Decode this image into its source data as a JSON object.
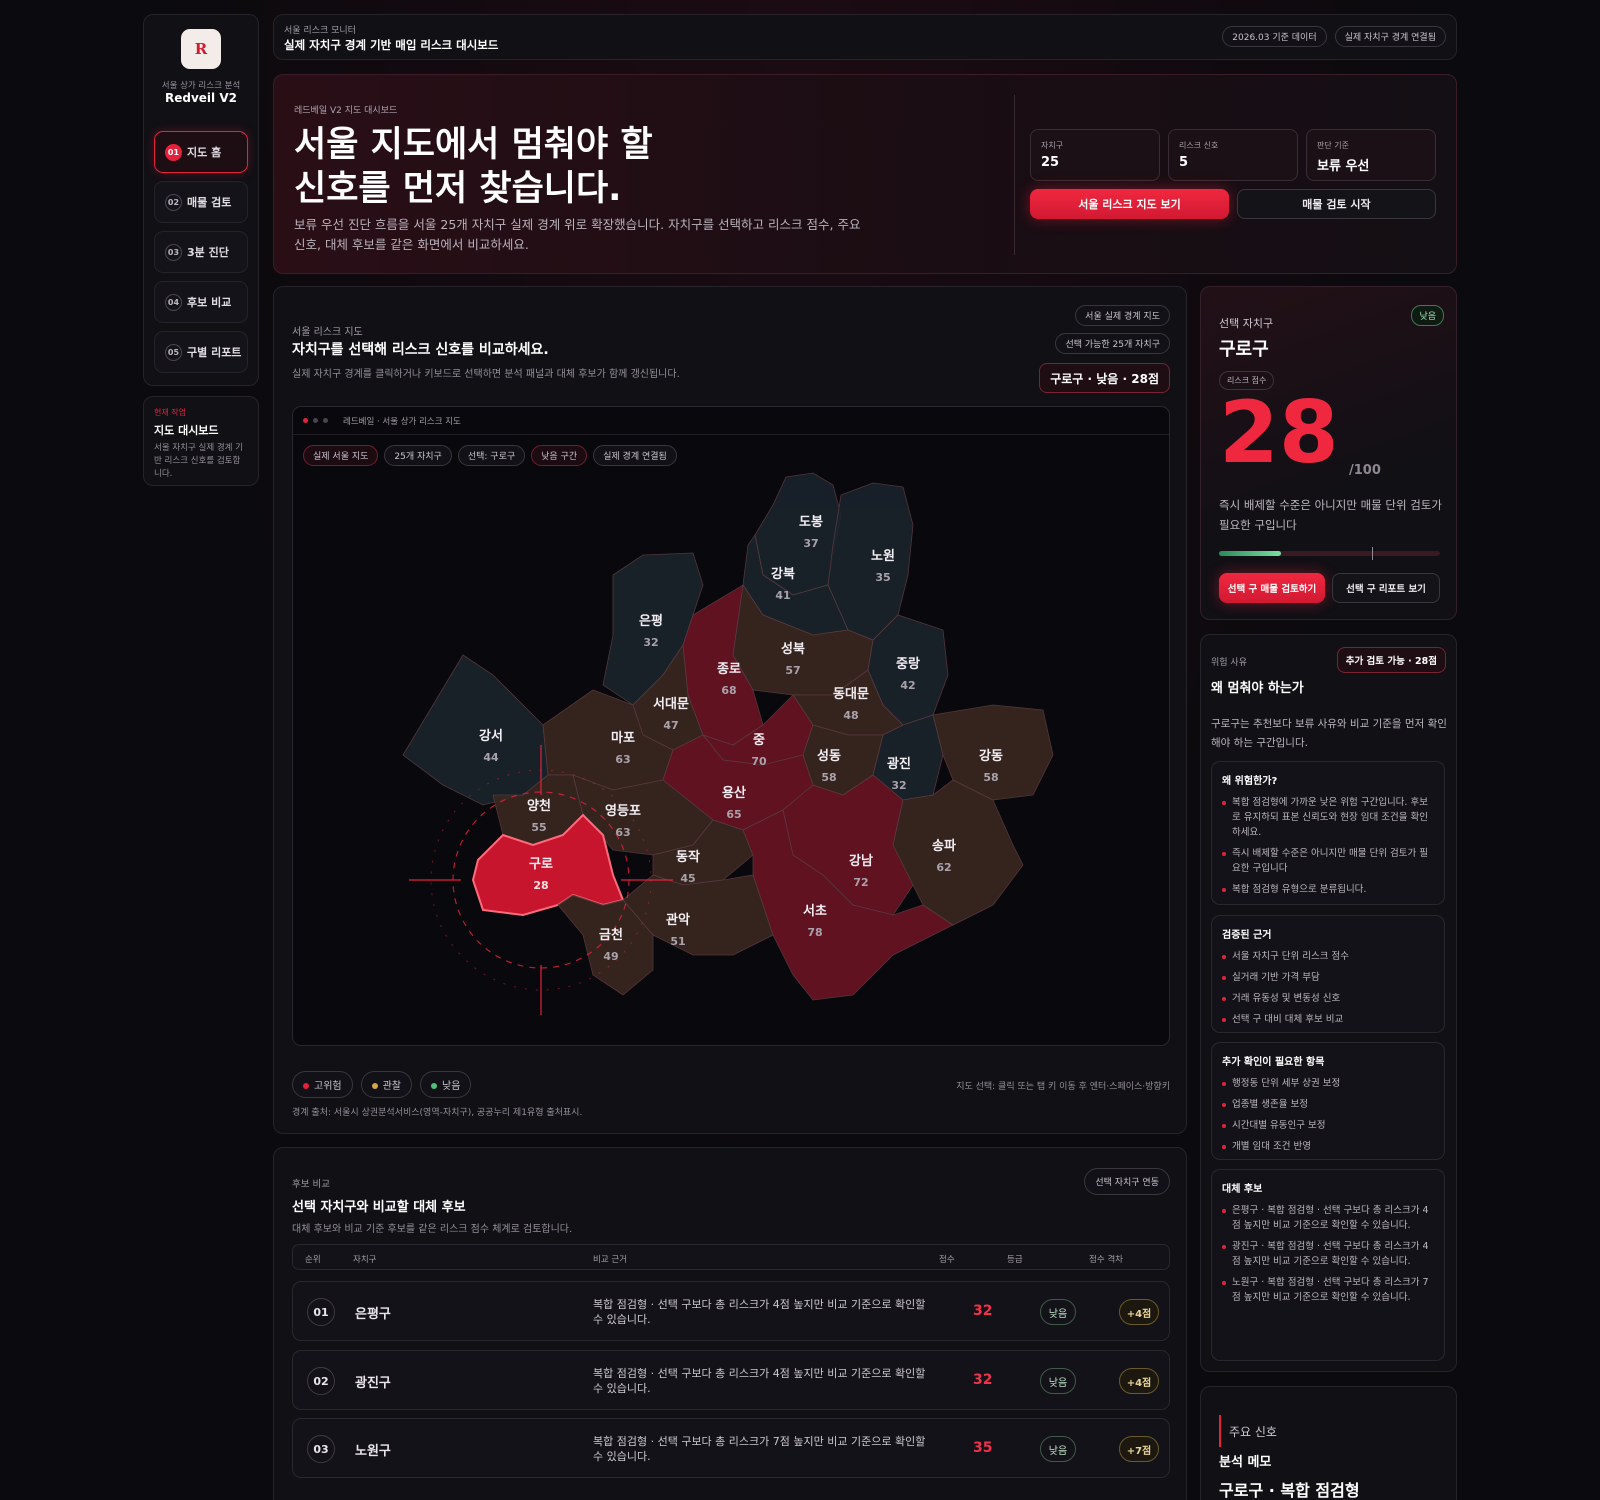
{
  "sidebar": {
    "subtitle": "서울 상가 리스크 분석",
    "brand": "Redveil V2",
    "items": [
      {
        "num": "01",
        "label": "지도 홈"
      },
      {
        "num": "02",
        "label": "매물 검토"
      },
      {
        "num": "03",
        "label": "3분 진단"
      },
      {
        "num": "04",
        "label": "후보 비교"
      },
      {
        "num": "05",
        "label": "구별 리포트"
      }
    ],
    "current": {
      "label": "현재 작업",
      "title": "지도 대시보드",
      "desc": "서울 자치구 실제 경계 기반 리스크 신호를 검토합니다."
    }
  },
  "topbar": {
    "eyebrow": "서울 리스크 모니터",
    "title": "실제 자치구 경계 기반 매입 리스크 대시보드",
    "badges": [
      "2026.03 기준 데이터",
      "실제 자치구 경계 연결됨"
    ]
  },
  "hero": {
    "eyebrow": "레드베일 V2 지도 대시보드",
    "title_line1": "서울 지도에서 멈춰야 할",
    "title_line2": "신호를 먼저 찾습니다.",
    "desc": "보류 우선 진단 흐름을 서울 25개 자치구 실제 경계 위로 확장했습니다. 자치구를 선택하고 리스크 점수, 주요 신호, 대체 후보를 같은 화면에서 비교하세요.",
    "stats": [
      {
        "label": "자치구",
        "value": "25"
      },
      {
        "label": "리스크 신호",
        "value": "5"
      },
      {
        "label": "판단 기준",
        "value": "보류 우선"
      }
    ],
    "btn_primary": "서울 리스크 지도 보기",
    "btn_secondary": "매물 검토 시작"
  },
  "map_section": {
    "eyebrow": "서울 리스크 지도",
    "title": "자치구를 선택해 리스크 신호를 비교하세요.",
    "desc": "실제 자치구 경계를 클릭하거나 키보드로 선택하면 분석 패널과 대체 후보가 함께 갱신됩니다.",
    "pill1": "서울 실제 경계 지도",
    "pill2": "선택 가능한 25개 자치구",
    "selected_badge": "구로구 · 낮음 · 28점",
    "window_title": "레드베일 · 서울 상가 리스크 지도",
    "chips": [
      "실제 서울 지도",
      "25개 자치구",
      "선택: 구로구",
      "낮음 구간",
      "실제 경계 연결됨"
    ],
    "legend": [
      "고위험",
      "관찰",
      "낮음"
    ],
    "hint": "지도 선택: 클릭 또는 탭 키 이동 후 엔터·스페이스·방향키",
    "source": "경계 출처: 서울시 상권분석서비스(영역-자치구), 공공누리 제1유형 출처표시."
  },
  "districts": [
    {
      "name": "도봉",
      "score": "37"
    },
    {
      "name": "노원",
      "score": "35"
    },
    {
      "name": "강북",
      "score": "41"
    },
    {
      "name": "은평",
      "score": "32"
    },
    {
      "name": "성북",
      "score": "57"
    },
    {
      "name": "종로",
      "score": "68"
    },
    {
      "name": "중랑",
      "score": "42"
    },
    {
      "name": "동대문",
      "score": "48"
    },
    {
      "name": "서대문",
      "score": "47"
    },
    {
      "name": "강서",
      "score": "44"
    },
    {
      "name": "마포",
      "score": "63"
    },
    {
      "name": "중",
      "score": "70"
    },
    {
      "name": "성동",
      "score": "58"
    },
    {
      "name": "광진",
      "score": "32"
    },
    {
      "name": "강동",
      "score": "58"
    },
    {
      "name": "용산",
      "score": "65"
    },
    {
      "name": "양천",
      "score": "55"
    },
    {
      "name": "영등포",
      "score": "63"
    },
    {
      "name": "구로",
      "score": "28"
    },
    {
      "name": "동작",
      "score": "45"
    },
    {
      "name": "강남",
      "score": "72"
    },
    {
      "name": "송파",
      "score": "62"
    },
    {
      "name": "서초",
      "score": "78"
    },
    {
      "name": "관악",
      "score": "51"
    },
    {
      "name": "금천",
      "score": "49"
    }
  ],
  "compare": {
    "eyebrow": "후보 비교",
    "title": "선택 자치구와 비교할 대체 후보",
    "desc": "대체 후보와 비교 기준 후보를 같은 리스크 점수 체계로 검토합니다.",
    "pill": "선택 자치구 연동",
    "headers": [
      "순위",
      "자치구",
      "비교 근거",
      "점수",
      "등급",
      "점수 격차"
    ],
    "rows": [
      {
        "rank": "01",
        "name": "은평구",
        "basis": "복합 점검형 · 선택 구보다 총 리스크가 4점 높지만 비교 기준으로 확인할 수 있습니다.",
        "score": "32",
        "grade": "낮음",
        "gap": "+4점"
      },
      {
        "rank": "02",
        "name": "광진구",
        "basis": "복합 점검형 · 선택 구보다 총 리스크가 4점 높지만 비교 기준으로 확인할 수 있습니다.",
        "score": "32",
        "grade": "낮음",
        "gap": "+4점"
      },
      {
        "rank": "03",
        "name": "노원구",
        "basis": "복합 점검형 · 선택 구보다 총 리스크가 7점 높지만 비교 기준으로 확인할 수 있습니다.",
        "score": "35",
        "grade": "낮음",
        "gap": "+7점"
      }
    ]
  },
  "selected": {
    "label": "선택 자치구",
    "name": "구로구",
    "grade": "낮음",
    "score_label": "리스크 점수",
    "score": "28",
    "max": "/100",
    "progress": 0.28,
    "desc": "즉시 배제할 수준은 아니지만 매물 단위 검토가 필요한 구입니다",
    "btn_review": "선택 구 매물 검토하기",
    "btn_report": "선택 구 리포트 보기"
  },
  "reasons": {
    "eyebrow": "위험 사유",
    "badge": "추가 검토 가능 · 28점",
    "title": "왜 멈춰야 하는가",
    "desc": "구로구는 추천보다 보류 사유와 비교 기준을 먼저 확인해야 하는 구간입니다.",
    "why": {
      "title": "왜 위험한가?",
      "items": [
        "복합 점검형에 가까운 낮은 위험 구간입니다. 후보로 유지하되 표본 신뢰도와 현장 임대 조건을 확인하세요.",
        "즉시 배제할 수준은 아니지만 매물 단위 검토가 필요한 구입니다",
        "복합 점검형 유형으로 분류됩니다."
      ]
    },
    "evidence": {
      "title": "검증된 근거",
      "items": [
        "서울 자치구 단위 리스크 점수",
        "실거래 기반 가격 부담",
        "거래 유동성 및 변동성 신호",
        "선택 구 대비 대체 후보 비교"
      ]
    },
    "check": {
      "title": "추가 확인이 필요한 항목",
      "items": [
        "행정동 단위 세부 상권 보정",
        "업종별 생존율 보정",
        "시간대별 유동인구 보정",
        "개별 임대 조건 반영"
      ]
    },
    "alts": {
      "title": "대체 후보",
      "items": [
        "은평구 · 복합 점검형 · 선택 구보다 총 리스크가 4점 높지만 비교 기준으로 확인할 수 있습니다.",
        "광진구 · 복합 점검형 · 선택 구보다 총 리스크가 4점 높지만 비교 기준으로 확인할 수 있습니다.",
        "노원구 · 복합 점검형 · 선택 구보다 총 리스크가 7점 높지만 비교 기준으로 확인할 수 있습니다."
      ]
    }
  },
  "memo": {
    "eyebrow": "주요 신호",
    "title": "분석 메모",
    "headline": "구로구 · 복합 점검형"
  },
  "colors": {
    "accent": "#e3223c",
    "high": "#6a1424",
    "watch": "#3a2820",
    "low": "#1a242c",
    "selected": "#c8152e"
  }
}
